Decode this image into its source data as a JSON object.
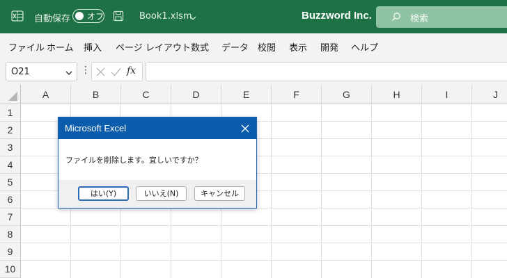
{
  "titlebar": {
    "autosave_label": "自動保存",
    "autosave_state": "オフ",
    "filename": "Book1.xlsm",
    "company": "Buzzword Inc.",
    "search_placeholder": "検索",
    "bg_color": "#1e7145"
  },
  "menu": {
    "items": [
      "ファイル",
      "ホーム",
      "挿入",
      "ページ レイアウト",
      "数式",
      "データ",
      "校閲",
      "表示",
      "開発",
      "ヘルプ"
    ]
  },
  "formula_bar": {
    "name_box": "O21",
    "fx": "fx",
    "formula": ""
  },
  "grid": {
    "columns": [
      "A",
      "B",
      "C",
      "D",
      "E",
      "F",
      "G",
      "H",
      "I",
      "J"
    ],
    "rows": [
      "1",
      "2",
      "3",
      "4",
      "5",
      "6",
      "7",
      "8",
      "9",
      "10"
    ]
  },
  "dialog": {
    "title": "Microsoft Excel",
    "message": "ファイルを削除します。宜しいですか？",
    "buttons": [
      "はい(Y)",
      "いいえ(N)",
      "キャンセル"
    ],
    "title_color": "#0b5cad"
  }
}
